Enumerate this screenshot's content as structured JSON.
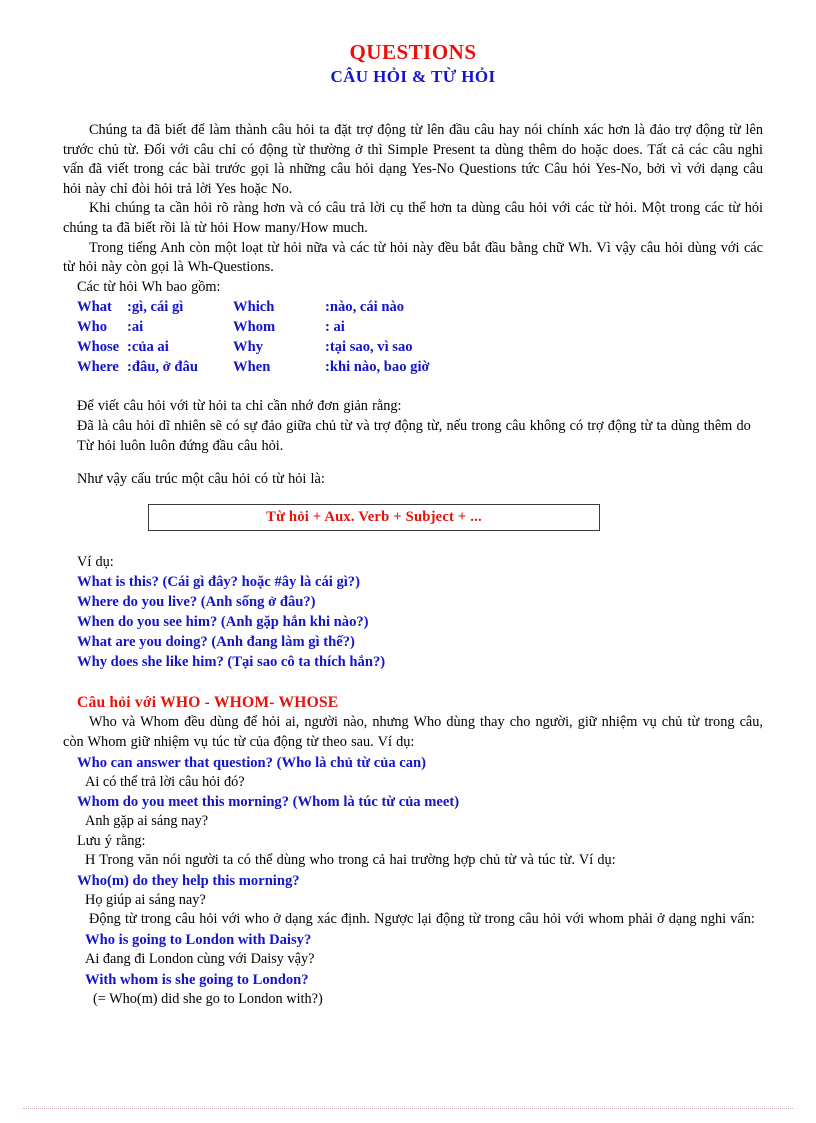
{
  "document": {
    "title_en": "QUESTIONS",
    "title_vi": "CÂU HỎI & TỪ HỎI",
    "colors": {
      "heading_red": "#E8120B",
      "example_blue": "#1414CC",
      "body_black": "#000000",
      "box_border": "#3a3a3a",
      "page_background": "#ffffff"
    }
  },
  "intro": {
    "p1": "Chúng ta đã biết để làm thành câu hỏi ta đặt trợ động từ lên đầu câu hay nói chính xác hơn là đảo trợ động từ lên trước chủ từ. Đối với câu chỉ có động từ thường ở thì Simple Present ta dùng thêm do hoặc does. Tất cả các câu nghi vấn đã viết trong các bài trước gọi là những câu hỏi dạng Yes-No Questions tức Câu hỏi Yes-No, bởi vì với dạng câu hỏi này chỉ đòi hỏi trả lời Yes hoặc No.",
    "p2": "Khi chúng ta cần hỏi rõ ràng hơn và có câu trả lời cụ thể hơn ta dùng câu hỏi với các từ hỏi. Một trong các từ hỏi chúng ta đã biết rồi là từ hỏi How many/How much.",
    "p3": "Trong tiếng Anh còn một loạt từ hỏi nữa và các từ hỏi này đều bắt đầu bằng chữ Wh. Vì vậy câu hỏi dùng với các từ hỏi này còn gọi là Wh-Questions.",
    "p4": "Các từ hỏi Wh bao gồm:"
  },
  "wh_table": {
    "rows": [
      {
        "word_a": "What",
        "mean_a": ":gì, cái gì",
        "word_b": "Which",
        "mean_b": ":nào, cái nào"
      },
      {
        "word_a": "Who",
        "mean_a": ":ai",
        "word_b": "Whom",
        "mean_b": ": ai"
      },
      {
        "word_a": "Whose",
        "mean_a": ":của ai",
        "word_b": "Why",
        "mean_b": ":tại sao, vì sao"
      },
      {
        "word_a": "Where",
        "mean_a": ":đâu, ở đâu",
        "word_b": "When",
        "mean_b": ":khi nào, bao giờ"
      }
    ]
  },
  "rules": {
    "r1": "Để viết câu hỏi với từ hỏi ta chỉ cần nhớ đơn giản rằng:",
    "r2": "Đã là câu hỏi dĩ nhiên sẽ có sự đảo giữa chủ từ và trợ động từ, nếu trong câu không có trợ động từ ta dùng thêm do",
    "r3": "Từ hỏi luôn luôn đứng đầu câu hỏi.",
    "r4": "Như vậy cấu trúc một câu hỏi có từ hỏi là:"
  },
  "formula": {
    "text": "Từ hỏi + Aux.  Verb + Subject + ..."
  },
  "examples": {
    "label": "Ví dụ:",
    "items": [
      "What is this? (Cái gì đây?  hoặc #ây là cái gì?)",
      "Where do you live? (Anh sống ở đâu?)",
      "When do you see him? (Anh gặp hắn khi nào?)",
      "What are you doing? (Anh đang làm gì thế?)",
      "Why does she like him? (Tại sao cô ta thích hắn?)"
    ]
  },
  "who_section": {
    "heading": "Câu hỏi với WHO - WHOM- WHOSE",
    "intro": "Who và Whom đều dùng để hỏi ai, người nào, nhưng Who dùng thay cho người, giữ nhiệm vụ chủ từ trong câu, còn Whom giữ nhiệm vụ túc từ của động từ theo sau. Ví dụ:",
    "ex1_en": "Who can answer that question? (Who là chủ từ của can)",
    "ex1_vi": "Ai có thể trả lời câu hỏi đó?",
    "ex2_en": "Whom do you meet this morning? (Whom là túc từ của meet)",
    "ex2_vi": "Anh gặp ai sáng nay?",
    "note_label": "Lưu ý rằng:",
    "note_body": "H Trong văn nói người ta có thể dùng who trong cả hai trường hợp chủ từ và túc từ. Ví dụ:",
    "ex3_en": "Who(m) do they help this morning?",
    "ex3_vi": "Họ giúp ai sáng nay?",
    "note2": "Động từ trong câu hỏi với who ở dạng xác định. Ngược lại động từ trong câu hỏi với whom phải ở dạng nghi vấn:",
    "ex4_en": "Who is going to London with Daisy?",
    "ex4_vi": "Ai đang đi London cùng với Daisy vậy?",
    "ex5_en": "With whom is she going to London?",
    "ex5_vi": "(= Who(m) did she go to London with?)"
  }
}
